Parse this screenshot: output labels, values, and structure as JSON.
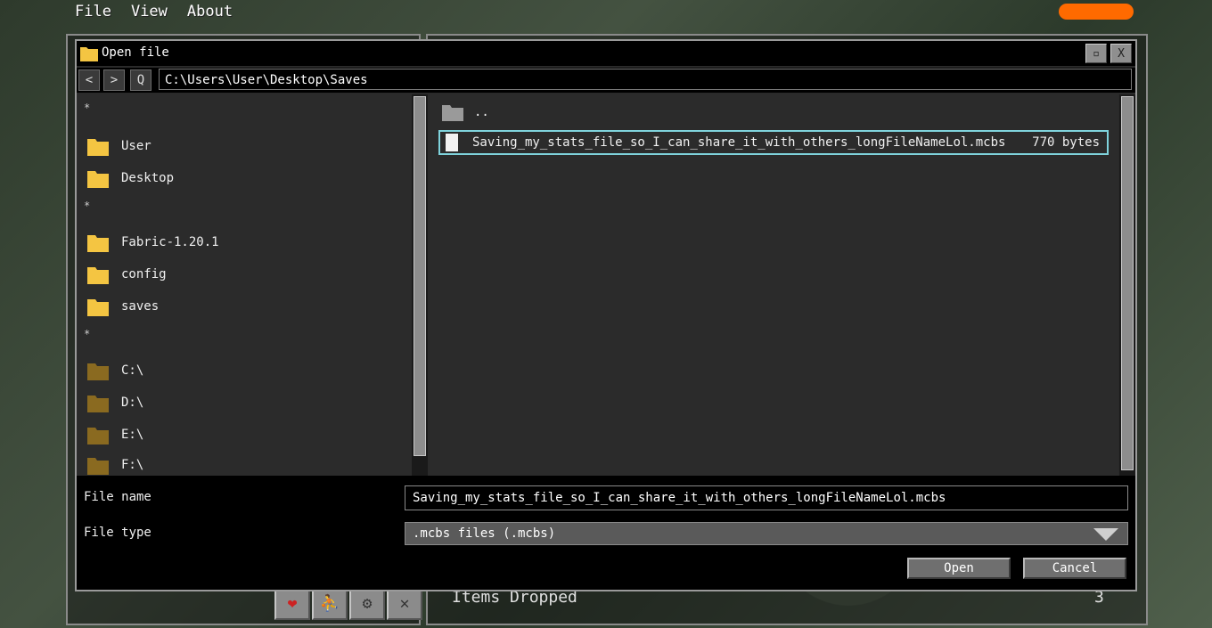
{
  "menu": {
    "file": "File",
    "view": "View",
    "about": "About"
  },
  "dialog": {
    "title": "Open file",
    "maximize_glyph": "▫",
    "close_glyph": "X",
    "nav": {
      "back": "<",
      "forward": ">",
      "refresh": "Q",
      "path": "C:\\Users\\User\\Desktop\\Saves"
    }
  },
  "sidebar": {
    "separators": [
      "*",
      "*",
      "*"
    ],
    "items": [
      {
        "label": "User",
        "kind": "user-folder"
      },
      {
        "label": "Desktop",
        "kind": "user-folder"
      },
      {
        "label": "Fabric-1.20.1",
        "kind": "user-folder"
      },
      {
        "label": "config",
        "kind": "user-folder"
      },
      {
        "label": "saves",
        "kind": "user-folder"
      },
      {
        "label": "C:\\",
        "kind": "drive"
      },
      {
        "label": "D:\\",
        "kind": "drive"
      },
      {
        "label": "E:\\",
        "kind": "drive"
      },
      {
        "label": "F:\\",
        "kind": "drive"
      }
    ]
  },
  "files": [
    {
      "name": "..",
      "size": "",
      "type": "parent-folder"
    },
    {
      "name": "Saving_my_stats_file_so_I_can_share_it_with_others_longFileNameLol.mcbs",
      "size": "770 bytes",
      "type": "file",
      "selected": true
    }
  ],
  "footer": {
    "file_name_label": "File name",
    "file_name_value": "Saving_my_stats_file_so_I_can_share_it_with_others_longFileNameLol.mcbs",
    "file_type_label": "File type",
    "file_type_value": ".mcbs files (.mcbs)",
    "open_label": "Open",
    "cancel_label": "Cancel"
  },
  "background": {
    "items_dropped_label": "Items Dropped",
    "items_dropped_count": "3"
  },
  "colors": {
    "folder_yellow": "#f4c542",
    "drive_folder": "#8a6a20",
    "parent_folder": "#9a9a9a",
    "selection_border": "#7fd3dc",
    "accent_orange": "#ff6a00"
  }
}
